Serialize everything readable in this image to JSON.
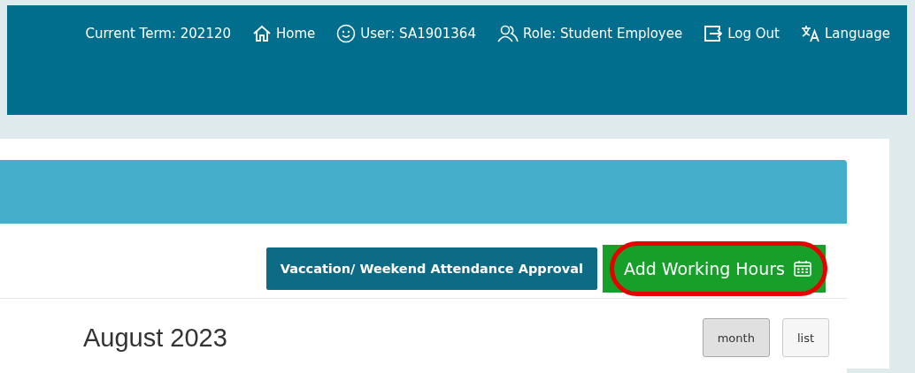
{
  "top_bar": {
    "items": [
      {
        "kind": "term",
        "label": "Current Term: 202120"
      },
      {
        "kind": "home",
        "label": "Home"
      },
      {
        "kind": "user",
        "label": "User: SA1901364"
      },
      {
        "kind": "role",
        "label": "Role: Student Employee"
      },
      {
        "kind": "logout",
        "label": "Log Out"
      },
      {
        "kind": "language",
        "label": "Language"
      }
    ]
  },
  "actions": [
    {
      "kind": "approval",
      "label": "Vaccation/ Weekend Attendance Approval",
      "highlighted": false
    },
    {
      "kind": "add",
      "label": "Add Working Hours",
      "highlighted": true
    }
  ],
  "calendar": {
    "title": "August 2023",
    "views": [
      {
        "label": "month",
        "selected": true
      },
      {
        "label": "list",
        "selected": false
      }
    ]
  }
}
